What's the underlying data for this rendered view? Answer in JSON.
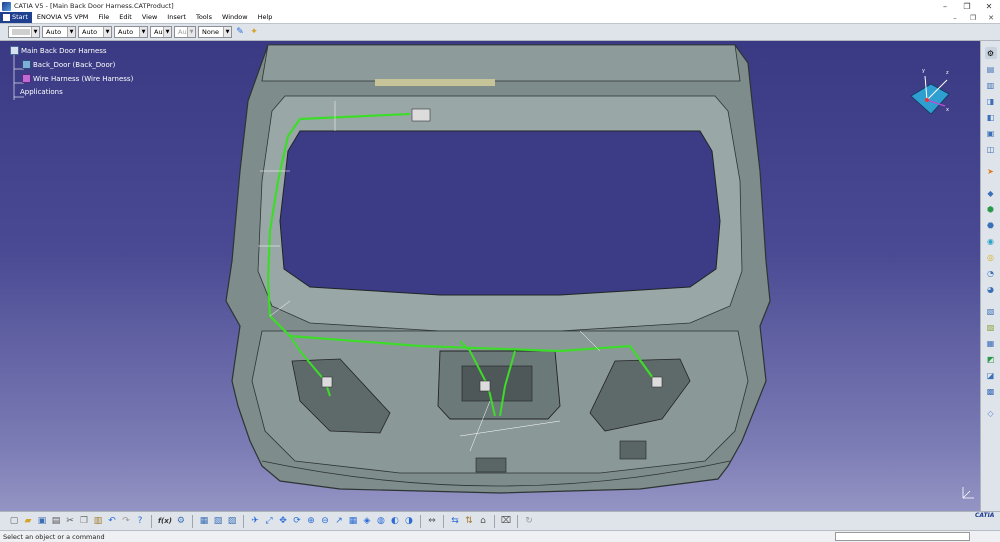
{
  "window": {
    "title": "CATIA V5 - [Main Back Door Harness.CATProduct]",
    "controls": [
      "–",
      "❐",
      "✕"
    ]
  },
  "menu": {
    "items": [
      "Start",
      "ENOVIA V5 VPM",
      "File",
      "Edit",
      "View",
      "Insert",
      "Tools",
      "Window",
      "Help"
    ],
    "doc_controls": [
      "–",
      "❐",
      "✕"
    ]
  },
  "toolbar_top": {
    "combos": [
      "",
      "Auto",
      "Auto",
      "Auto",
      "Aut",
      "Aut",
      "None"
    ]
  },
  "tree": {
    "root": "Main Back Door Harness",
    "children": [
      "Back_Door (Back_Door)",
      "Wire Harness (Wire Harness)",
      "Applications"
    ]
  },
  "toolbar_bottom": {
    "formula_label": "f(x)"
  },
  "status": {
    "prompt": "Select an object or a command"
  },
  "branding": {
    "logo_text": "CATIA"
  },
  "compass": {
    "axes": [
      "x",
      "y",
      "z"
    ]
  },
  "colors": {
    "viewport_top": "#3a3a84",
    "viewport_bottom": "#9494c4",
    "harness": "#3ddc2a",
    "door": "#7e8c8c",
    "start_menu": "#1f3f8f"
  }
}
